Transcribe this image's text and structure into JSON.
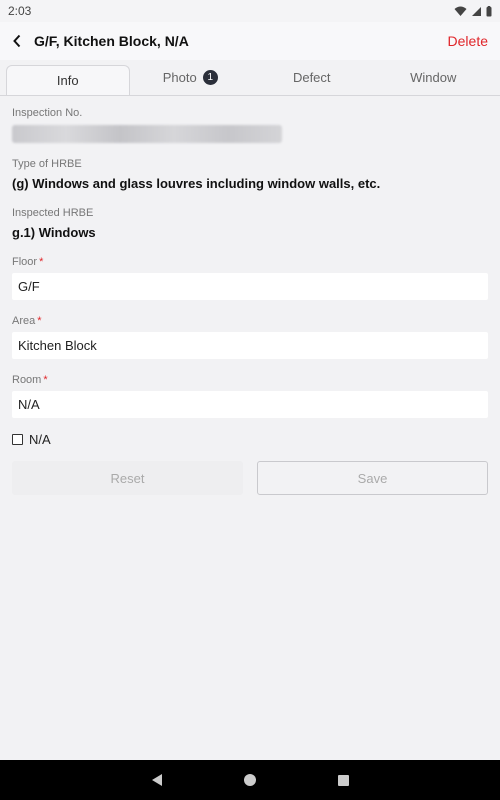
{
  "status_bar": {
    "time": "2:03"
  },
  "header": {
    "title": "G/F, Kitchen Block, N/A",
    "delete_label": "Delete"
  },
  "tabs": [
    {
      "label": "Info",
      "active": true
    },
    {
      "label": "Photo",
      "badge": "1"
    },
    {
      "label": "Defect"
    },
    {
      "label": "Window"
    }
  ],
  "form": {
    "inspection_no_label": "Inspection No.",
    "type_label": "Type of HRBE",
    "type_value": "(g) Windows and glass louvres including window walls, etc.",
    "inspected_label": "Inspected HRBE",
    "inspected_value": "g.1) Windows",
    "floor_label": "Floor",
    "floor_value": "G/F",
    "area_label": "Area",
    "area_value": "Kitchen Block",
    "room_label": "Room",
    "room_value": "N/A",
    "required_mark": "*",
    "na_checkbox_label": "N/A",
    "reset_label": "Reset",
    "save_label": "Save"
  },
  "colors": {
    "accent_red": "#e0262a",
    "badge_bg": "#2b2f3a"
  }
}
